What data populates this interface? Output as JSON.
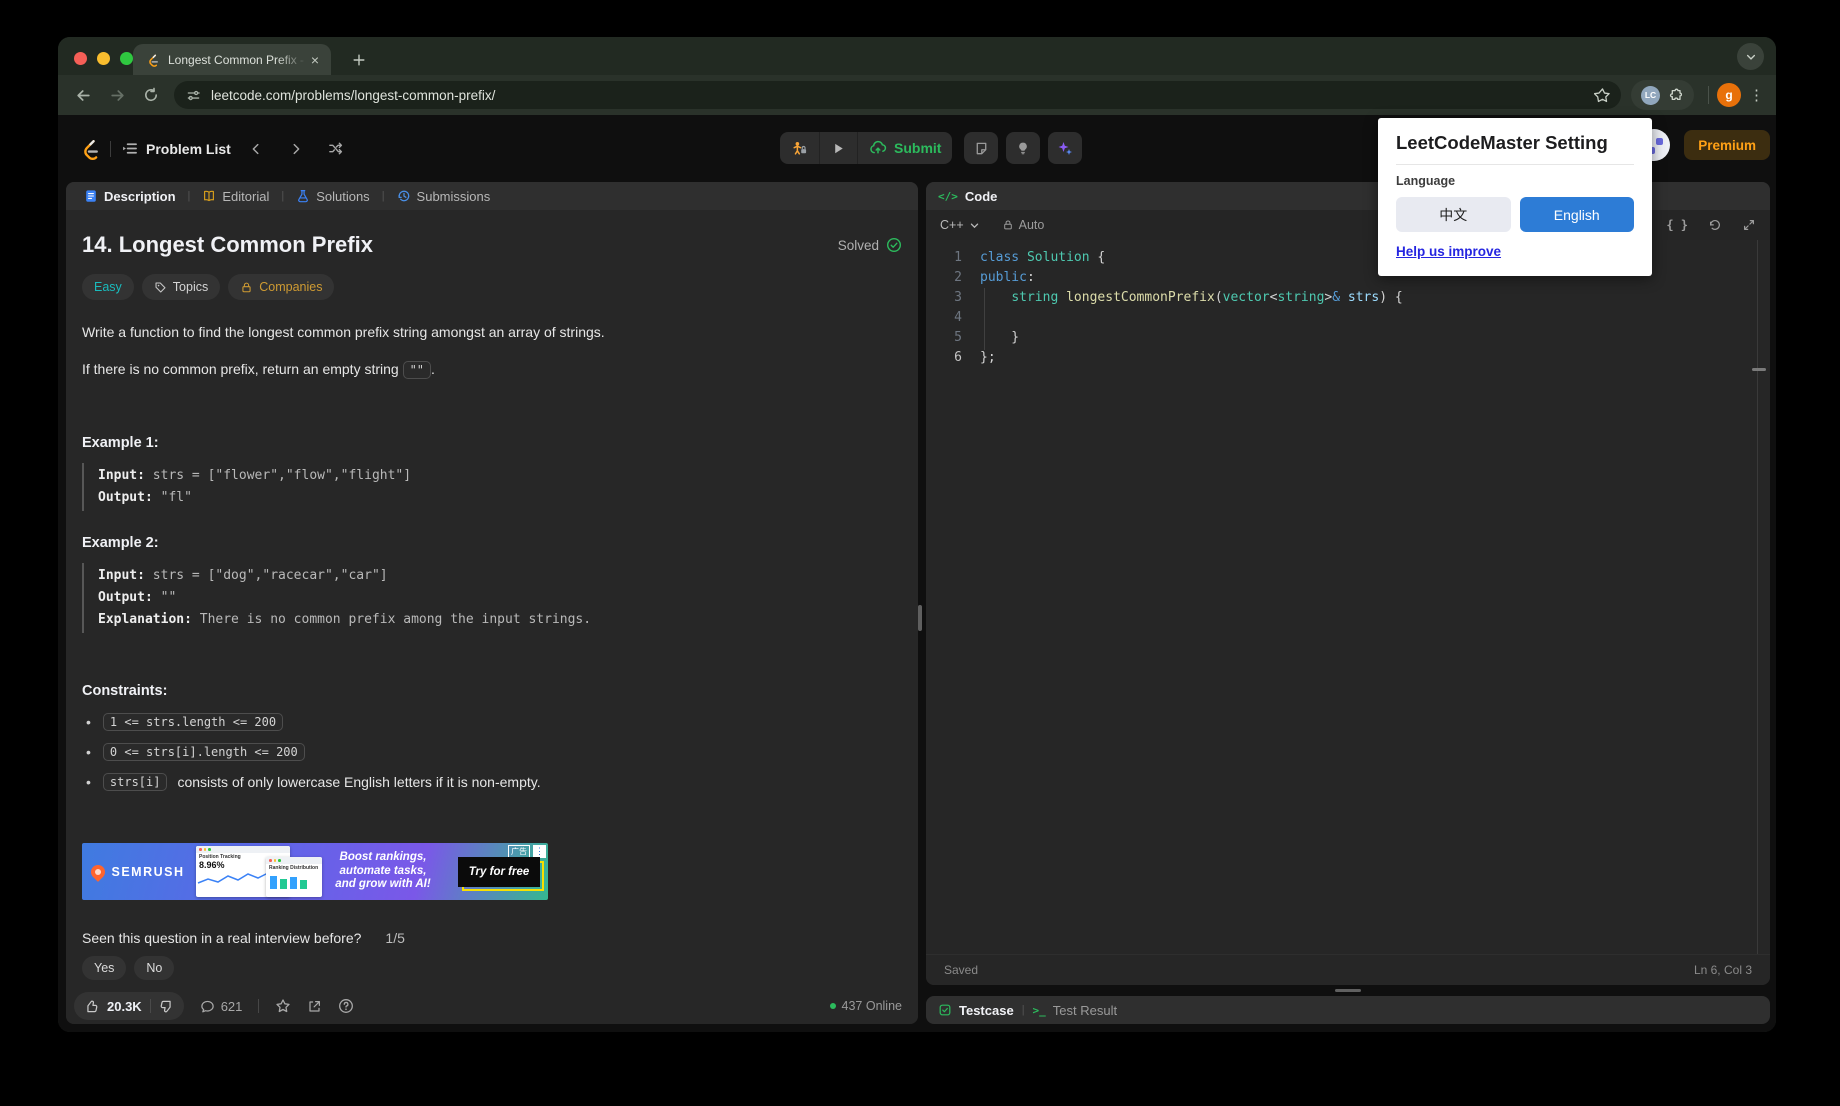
{
  "browser": {
    "tab_title": "Longest Common Prefix - Lee",
    "url": "leetcode.com/problems/longest-common-prefix/",
    "extension_badge": "LC",
    "profile_initial": "g"
  },
  "nav": {
    "problem_list_label": "Problem List",
    "submit_label": "Submit",
    "premium_label": "Premium"
  },
  "panel_tabs": {
    "description": "Description",
    "editorial": "Editorial",
    "solutions": "Solutions",
    "submissions": "Submissions"
  },
  "problem": {
    "title": "14. Longest Common Prefix",
    "solved_label": "Solved",
    "difficulty": "Easy",
    "topics_label": "Topics",
    "companies_label": "Companies",
    "statement_1": "Write a function to find the longest common prefix string amongst an array of strings.",
    "statement_2_prefix": "If there is no common prefix, return an empty string ",
    "statement_2_code": "\"\"",
    "statement_2_suffix": ".",
    "example1_label": "Example 1:",
    "example2_label": "Example 2:",
    "examples": [
      {
        "lines": [
          {
            "key": "Input:",
            "value": " strs = [\"flower\",\"flow\",\"flight\"]"
          },
          {
            "key": "Output:",
            "value": " \"fl\""
          }
        ]
      },
      {
        "lines": [
          {
            "key": "Input:",
            "value": " strs = [\"dog\",\"racecar\",\"car\"]"
          },
          {
            "key": "Output:",
            "value": " \"\""
          },
          {
            "key": "Explanation:",
            "value": " There is no common prefix among the input strings."
          }
        ]
      }
    ],
    "constraints_label": "Constraints:",
    "constraints": [
      {
        "code": "1 <= strs.length <= 200",
        "text": ""
      },
      {
        "code": "0 <= strs[i].length <= 200",
        "text": ""
      },
      {
        "code": "strs[i]",
        "text": " consists of only lowercase English letters if it is non-empty."
      }
    ]
  },
  "ad": {
    "brand": "SEMRUSH",
    "card1_title": "Position Tracking",
    "card1_value": "8.96%",
    "card2_title": "Ranking Distribution",
    "headline1": "Boost rankings,",
    "headline2": "automate tasks,",
    "headline3": "and grow with AI!",
    "cta": "Try for free",
    "ad_label": "广告"
  },
  "footer": {
    "question": "Seen this question in a real interview before?",
    "progress": "1/5",
    "yes": "Yes",
    "no": "No",
    "likes": "20.3K",
    "comments": "621",
    "online": "437 Online"
  },
  "editor": {
    "panel_title": "Code",
    "code_icon": "</>",
    "language": "C++",
    "auto_label": "Auto",
    "saved_label": "Saved",
    "cursor_pos": "Ln 6, Col 3",
    "lines": [
      {
        "n": "1",
        "tokens": [
          [
            "kw",
            "class"
          ],
          [
            "pl",
            " "
          ],
          [
            "type",
            "Solution"
          ],
          [
            "pl",
            " {"
          ]
        ]
      },
      {
        "n": "2",
        "tokens": [
          [
            "kw",
            "public"
          ],
          [
            "pl",
            ":"
          ]
        ]
      },
      {
        "n": "3",
        "tokens": [
          [
            "pl",
            "    "
          ],
          [
            "type",
            "string"
          ],
          [
            "pl",
            " "
          ],
          [
            "fn",
            "longestCommonPrefix"
          ],
          [
            "pl",
            "("
          ],
          [
            "type",
            "vector"
          ],
          [
            "pl",
            "<"
          ],
          [
            "type",
            "string"
          ],
          [
            "pl",
            ">"
          ],
          [
            "kw",
            "&"
          ],
          [
            "pl",
            " "
          ],
          [
            "var",
            "strs"
          ],
          [
            "pl",
            ") {"
          ]
        ]
      },
      {
        "n": "4",
        "tokens": []
      },
      {
        "n": "5",
        "tokens": [
          [
            "pl",
            "    }"
          ]
        ]
      },
      {
        "n": "6",
        "active": true,
        "tokens": [
          [
            "pl",
            "};"
          ]
        ]
      }
    ]
  },
  "console": {
    "testcase_label": "Testcase",
    "test_result_label": "Test Result",
    "terminal_icon": ">_"
  },
  "popup": {
    "title": "LeetCodeMaster Setting",
    "language_label": "Language",
    "option_zh": "中文",
    "option_en": "English",
    "link": "Help us improve"
  },
  "colors": {
    "accent_green": "#2cbb5d",
    "easy_teal": "#1abbbc",
    "premium_orange": "#ffa116",
    "brand_orange": "#ffa116",
    "english_button_blue": "#2d7cd6",
    "link_blue": "#2525e0",
    "online_green": "#2cbb5d"
  }
}
